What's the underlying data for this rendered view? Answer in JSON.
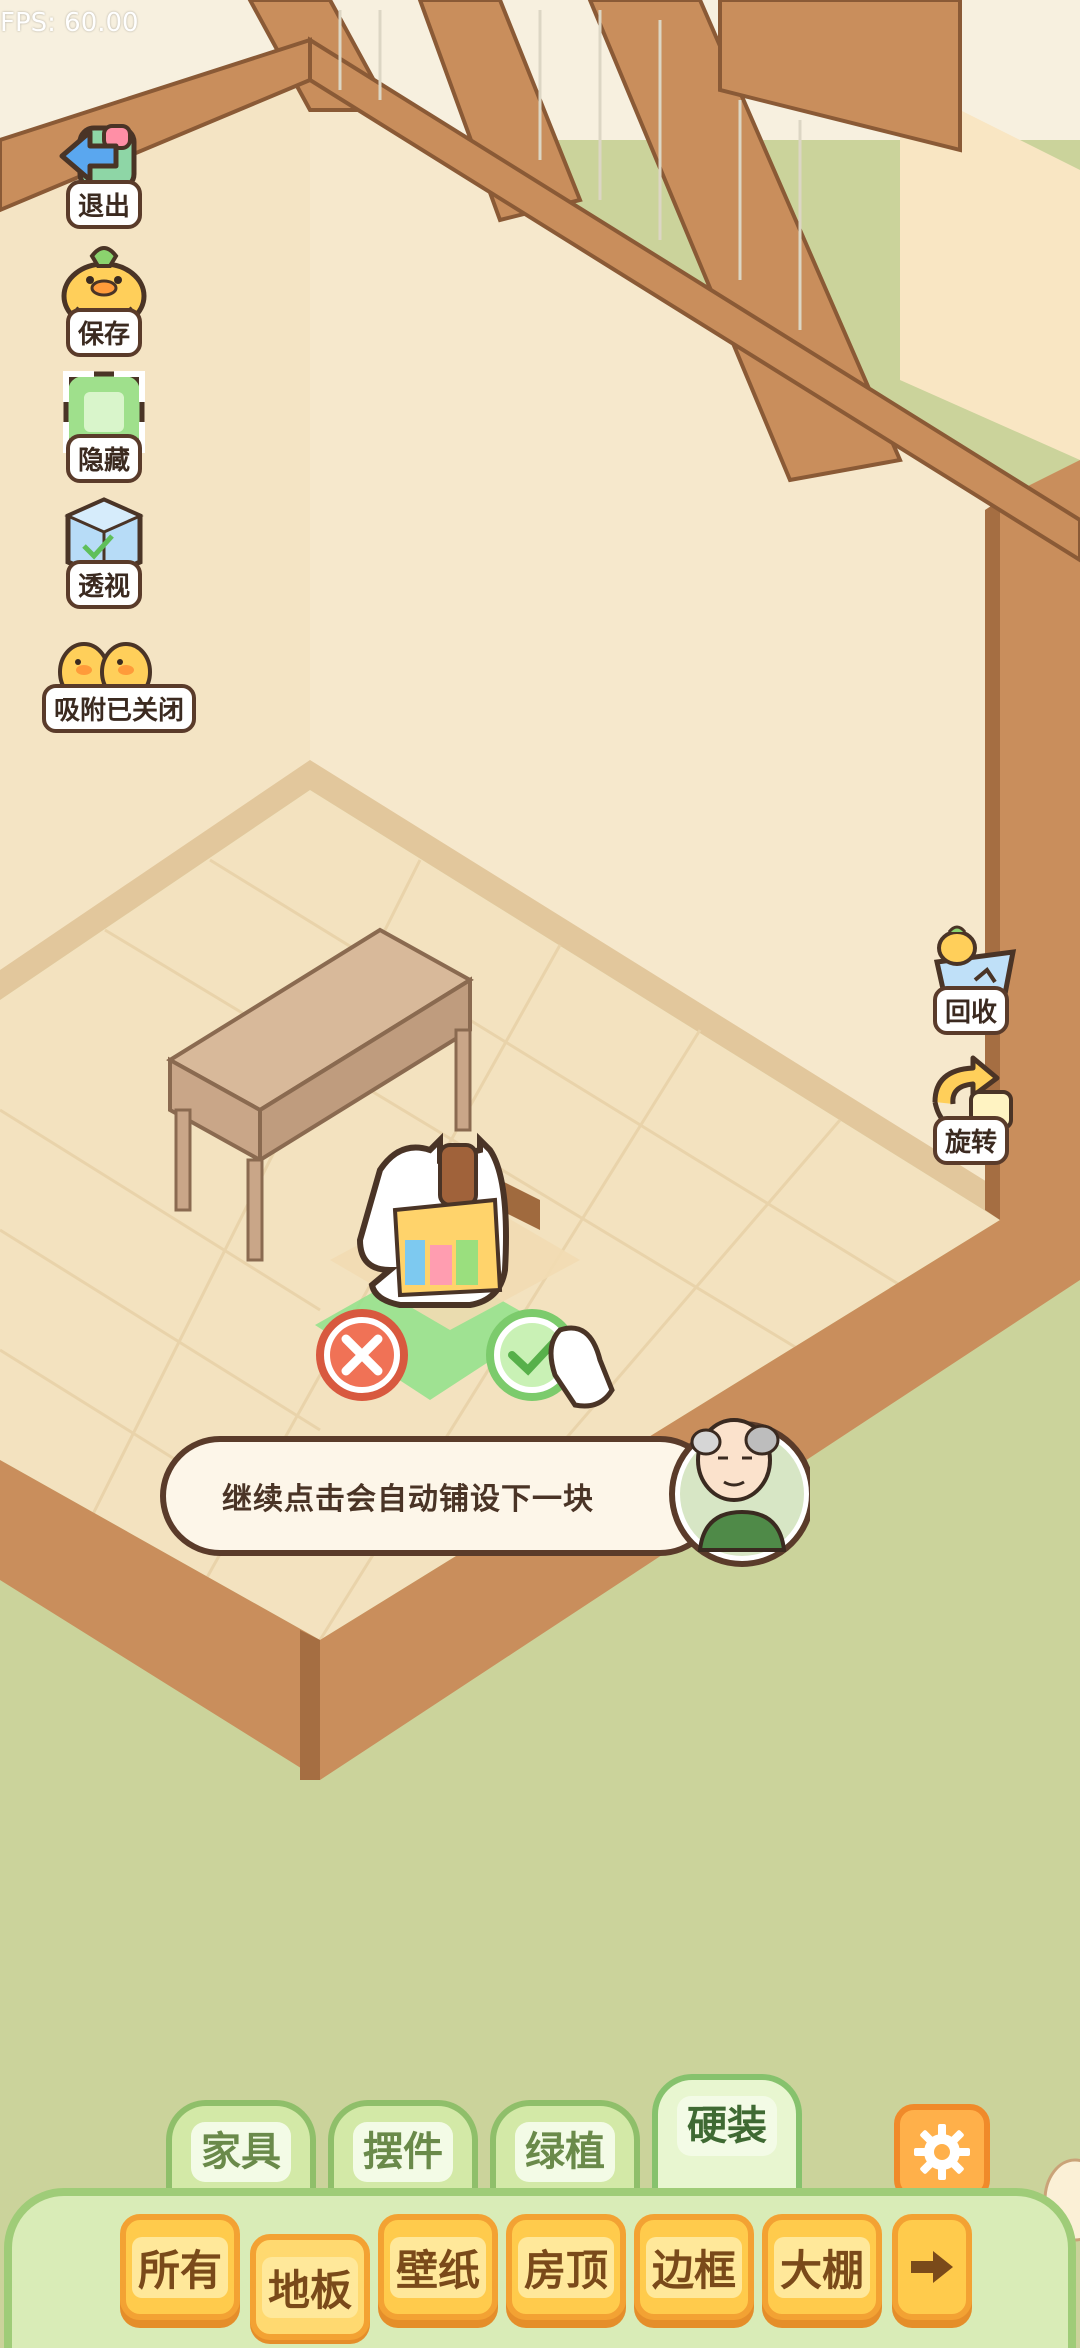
{
  "hud": {
    "fps": "FPS: 60.00"
  },
  "left_tools": [
    {
      "label": "退出",
      "icon": "exit-arrow-icon"
    },
    {
      "label": "保存",
      "icon": "save-duck-icon"
    },
    {
      "label": "隐藏",
      "icon": "hide-frame-icon"
    },
    {
      "label": "透视",
      "icon": "perspective-cube-icon"
    },
    {
      "label": "吸附已关闭",
      "icon": "snap-ducks-icon"
    }
  ],
  "right_tools": [
    {
      "label": "回收",
      "icon": "recycle-duck-icon"
    },
    {
      "label": "旋转",
      "icon": "rotate-icon"
    }
  ],
  "dialog": {
    "text": "继续点击会自动铺设下一块"
  },
  "category_tabs": [
    "家具",
    "摆件",
    "绿植",
    "硬装"
  ],
  "active_category": "硬装",
  "sub_tabs": [
    "所有",
    "地板",
    "壁纸",
    "房顶",
    "边框",
    "大棚"
  ],
  "active_sub_tab": "地板",
  "colors": {
    "ground": "#cbd39b",
    "wall": "#f6e8cc",
    "floor": "#f3e2bf",
    "wood": "#c98e5c",
    "tab_green": "#d3e9a7",
    "button_yellow": "#ffcb4c"
  }
}
